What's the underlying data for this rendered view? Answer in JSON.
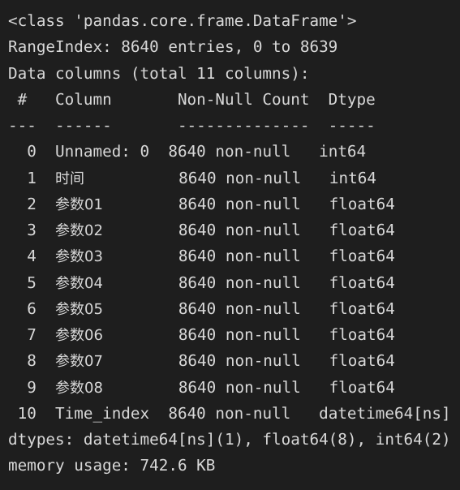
{
  "console": {
    "background_color": "#1e1e1e",
    "text_color": "#d8d8d8",
    "title": "pandas DataFrame info output"
  },
  "output": {
    "class_line": "<class 'pandas.core.frame.DataFrame'>",
    "range_index_line": "RangeIndex: 8640 entries, 0 to 8639",
    "data_columns_line": "Data columns (total 11 columns):",
    "header_line": " #   Column       Non-Null Count  Dtype",
    "separator_line": "---  ------       --------------  -----",
    "dtypes_line": "dtypes: datetime64[ns](1), float64(8), int64(2)",
    "memory_line": "memory usage: 742.6 KB"
  },
  "summary": {
    "class_name": "pandas.core.frame.DataFrame",
    "index_type": "RangeIndex",
    "entries": 8640,
    "index_start": 0,
    "index_end": 8639,
    "total_columns": 11,
    "dtypes_summary": "datetime64[ns](1), float64(8), int64(2)",
    "memory_usage": "742.6 KB"
  },
  "table": {
    "headers": [
      "#",
      "Column",
      "Non-Null Count",
      "Dtype"
    ],
    "rows": [
      {
        "index": "  0",
        "column": "Unnamed: 0",
        "column_cjk": false,
        "pad_after_column": "  ",
        "non_null": "8640 non-null",
        "gap": "   ",
        "dtype": "int64"
      },
      {
        "index": "  1",
        "column": "时间",
        "column_cjk": true,
        "pad_after_column": "          ",
        "non_null": "8640 non-null",
        "gap": "   ",
        "dtype": "int64"
      },
      {
        "index": "  2",
        "column": "参数01",
        "column_cjk": true,
        "pad_after_column": "        ",
        "non_null": "8640 non-null",
        "gap": "   ",
        "dtype": "float64"
      },
      {
        "index": "  3",
        "column": "参数02",
        "column_cjk": true,
        "pad_after_column": "        ",
        "non_null": "8640 non-null",
        "gap": "   ",
        "dtype": "float64"
      },
      {
        "index": "  4",
        "column": "参数03",
        "column_cjk": true,
        "pad_after_column": "        ",
        "non_null": "8640 non-null",
        "gap": "   ",
        "dtype": "float64"
      },
      {
        "index": "  5",
        "column": "参数04",
        "column_cjk": true,
        "pad_after_column": "        ",
        "non_null": "8640 non-null",
        "gap": "   ",
        "dtype": "float64"
      },
      {
        "index": "  6",
        "column": "参数05",
        "column_cjk": true,
        "pad_after_column": "        ",
        "non_null": "8640 non-null",
        "gap": "   ",
        "dtype": "float64"
      },
      {
        "index": "  7",
        "column": "参数06",
        "column_cjk": true,
        "pad_after_column": "        ",
        "non_null": "8640 non-null",
        "gap": "   ",
        "dtype": "float64"
      },
      {
        "index": "  8",
        "column": "参数07",
        "column_cjk": true,
        "pad_after_column": "        ",
        "non_null": "8640 non-null",
        "gap": "   ",
        "dtype": "float64"
      },
      {
        "index": "  9",
        "column": "参数08",
        "column_cjk": true,
        "pad_after_column": "        ",
        "non_null": "8640 non-null",
        "gap": "   ",
        "dtype": "float64"
      },
      {
        "index": " 10",
        "column": "Time_index",
        "column_cjk": false,
        "pad_after_column": "  ",
        "non_null": "8640 non-null",
        "gap": "   ",
        "dtype": "datetime64[ns]"
      }
    ]
  }
}
